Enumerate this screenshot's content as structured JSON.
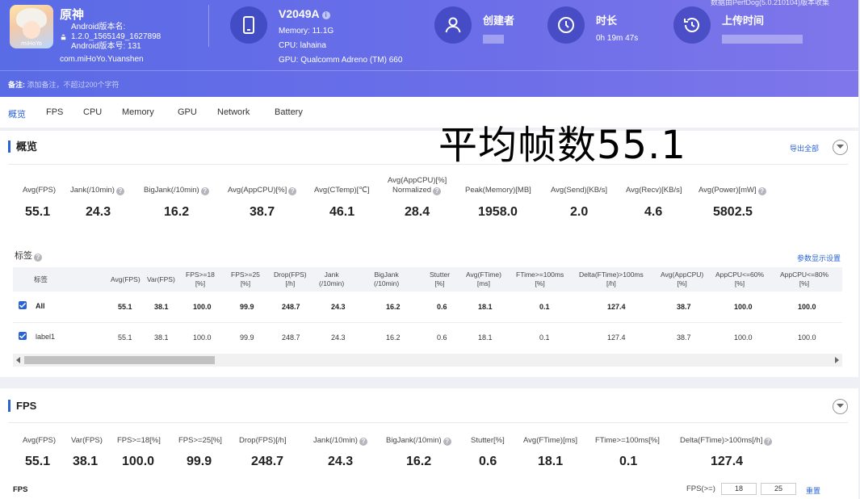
{
  "header": {
    "app_name": "原神",
    "app_icon_text": "miHoYo",
    "android_version_label": "Android版本名:",
    "android_version_value": "1.2.0_1565149_1627898",
    "android_build_label": "Android版本号: 131",
    "package": "com.miHoYo.Yuanshen",
    "device_name": "V2049A",
    "memory": "Memory: 11.1G",
    "cpu": "CPU: lahaina",
    "gpu": "GPU: Qualcomm Adreno (TM) 660",
    "creator_label": "创建者",
    "duration_label": "时长",
    "duration_value": "0h 19m 47s",
    "upload_label": "上传时间",
    "top_note": "数据由PerfDog(5.0.210104)版本收集",
    "remark_label": "备注:",
    "remark_placeholder": "添加备注，不超过200个字符"
  },
  "tabs": [
    "概览",
    "FPS",
    "CPU",
    "Memory",
    "GPU",
    "Network",
    "Battery"
  ],
  "annotation": "平均帧数55.1",
  "overview": {
    "title": "概览",
    "export_label": "导出全部",
    "stats": [
      {
        "label": "Avg(FPS)",
        "value": "55.1"
      },
      {
        "label": "Jank(/10min)",
        "value": "24.3"
      },
      {
        "label": "BigJank(/10min)",
        "value": "16.2"
      },
      {
        "label": "Avg(AppCPU)[%]",
        "value": "38.7"
      },
      {
        "label": "Avg(CTemp)[℃]",
        "value": "46.1"
      },
      {
        "label": "Avg(AppCPU)[%]",
        "label2": "Normalized",
        "value": "28.4"
      },
      {
        "label": "Peak(Memory)[MB]",
        "value": "1958.0"
      },
      {
        "label": "Avg(Send)[KB/s]",
        "value": "2.0"
      },
      {
        "label": "Avg(Recv)[KB/s]",
        "value": "4.6"
      },
      {
        "label": "Avg(Power)[mW]",
        "value": "5802.5"
      }
    ],
    "labels_title": "标签",
    "param_settings": "参数显示设置",
    "table": {
      "headers": [
        [
          "标签"
        ],
        [
          "Avg(FPS)"
        ],
        [
          "Var(FPS)"
        ],
        [
          "FPS>=18",
          "[%]"
        ],
        [
          "FPS>=25",
          "[%]"
        ],
        [
          "Drop(FPS)",
          "[/h]"
        ],
        [
          "Jank",
          "(/10min)"
        ],
        [
          "BigJank",
          "(/10min)"
        ],
        [
          "Stutter",
          "[%]"
        ],
        [
          "Avg(FTime)",
          "[ms]"
        ],
        [
          "FTime>=100ms",
          "[%]"
        ],
        [
          "Delta(FTime)>100ms",
          "[/h]"
        ],
        [
          "Avg(AppCPU)",
          "[%]"
        ],
        [
          "AppCPU<=60%",
          "[%]"
        ],
        [
          "AppCPU<=80%",
          "[%]"
        ]
      ],
      "rows": [
        {
          "label": "All",
          "cells": [
            "55.1",
            "38.1",
            "100.0",
            "99.9",
            "248.7",
            "24.3",
            "16.2",
            "0.6",
            "18.1",
            "0.1",
            "127.4",
            "38.7",
            "100.0",
            "100.0"
          ]
        },
        {
          "label": "label1",
          "cells": [
            "55.1",
            "38.1",
            "100.0",
            "99.9",
            "248.7",
            "24.3",
            "16.2",
            "0.6",
            "18.1",
            "0.1",
            "127.4",
            "38.7",
            "100.0",
            "100.0"
          ]
        }
      ]
    }
  },
  "fps": {
    "title": "FPS",
    "stats": [
      {
        "label": "Avg(FPS)",
        "value": "55.1"
      },
      {
        "label": "Var(FPS)",
        "value": "38.1"
      },
      {
        "label": "FPS>=18[%]",
        "value": "100.0"
      },
      {
        "label": "FPS>=25[%]",
        "value": "99.9"
      },
      {
        "label": "Drop(FPS)[/h]",
        "value": "248.7"
      },
      {
        "label": "Jank(/10min)",
        "value": "24.3"
      },
      {
        "label": "BigJank(/10min)",
        "value": "16.2"
      },
      {
        "label": "Stutter[%]",
        "value": "0.6"
      },
      {
        "label": "Avg(FTime)[ms]",
        "value": "18.1"
      },
      {
        "label": "FTime>=100ms[%]",
        "value": "0.1"
      },
      {
        "label": "Delta(FTime)>100ms[/h]",
        "value": "127.4"
      }
    ],
    "chart_label": "FPS",
    "threshold_label": "FPS(>=)",
    "threshold1": "18",
    "threshold2": "25",
    "reset_label": "重置"
  }
}
